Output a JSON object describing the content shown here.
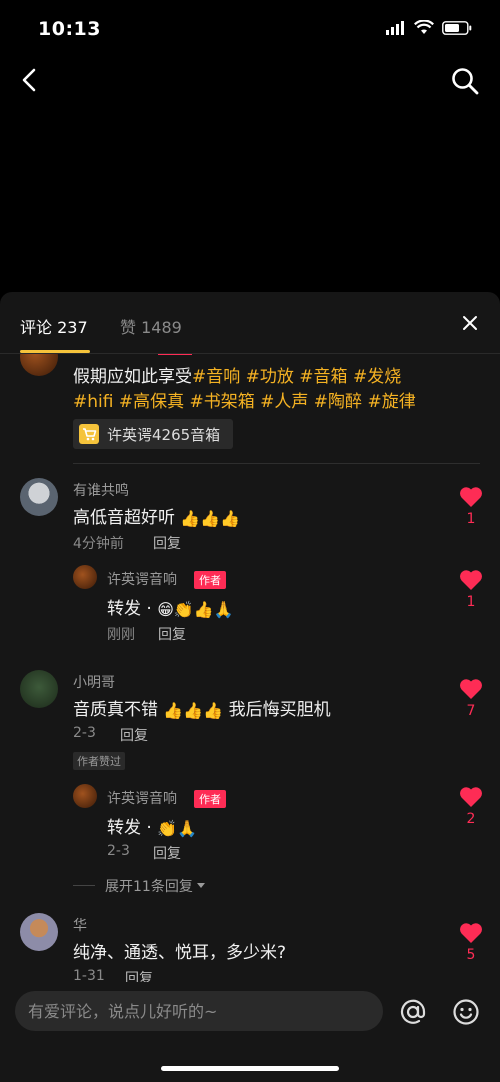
{
  "status": {
    "time": "10:13"
  },
  "tabs": {
    "comments": "评论 237",
    "likes": "赞 1489"
  },
  "comments": [
    {
      "text_plain": "假期应如此享受",
      "tags_line1": "#音响 #功放 #音箱 #发烧",
      "tags_line2": "#hifi #高保真 #书架箱 #人声 #陶醉 #旋律",
      "product": "许英谔4265音箱"
    },
    {
      "name": "有谁共鸣",
      "text": "高低音超好听",
      "time": "4分钟前",
      "reply": "回复",
      "likes": "1",
      "replies": [
        {
          "name": "许英谔音响",
          "badge": "作者",
          "text": "转发 ·",
          "time": "刚刚",
          "reply": "回复",
          "likes": "1"
        }
      ]
    },
    {
      "name": "小明哥",
      "text": "音质真不错",
      "text_tail": "我后悔买胆机",
      "time": "2-3",
      "reply": "回复",
      "liked_by_author": "作者赞过",
      "likes": "7",
      "replies": [
        {
          "name": "许英谔音响",
          "badge": "作者",
          "text": "转发 ·",
          "time": "2-3",
          "reply": "回复",
          "likes": "2"
        }
      ],
      "expand": "展开11条回复"
    },
    {
      "name": "华",
      "text": "纯净、通透、悦耳，多少米?",
      "time": "1-31",
      "reply": "回复",
      "likes": "5"
    }
  ],
  "input": {
    "placeholder": "有爱评论，说点儿好听的~"
  },
  "colors": {
    "accent": "#f5c33b",
    "like": "#fe2c55",
    "tag": "#f5b223",
    "sheet": "#161616"
  },
  "icons": [
    "back-icon",
    "search-icon",
    "close-icon",
    "heart-icon",
    "cart-icon",
    "at-icon",
    "emoji-icon"
  ]
}
